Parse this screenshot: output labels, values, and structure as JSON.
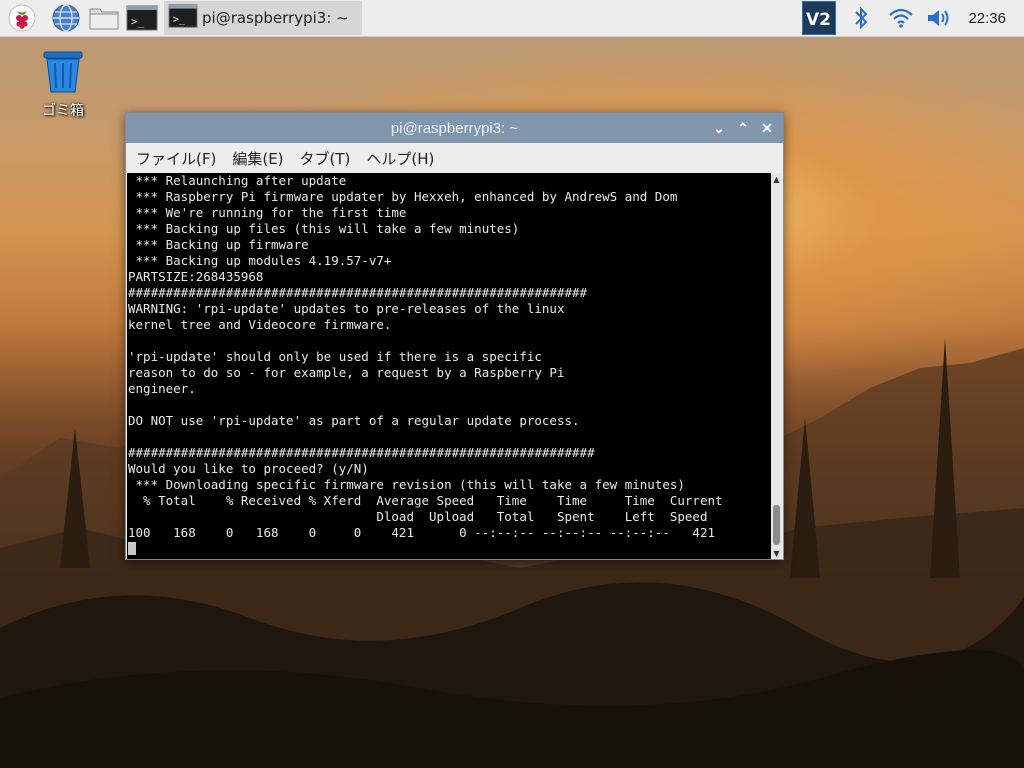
{
  "taskbar": {
    "menu_icon": "raspberry-menu-icon",
    "launchers": [
      "web-browser-icon",
      "file-manager-icon",
      "terminal-icon"
    ],
    "task_title": "pi@raspberrypi3: ~",
    "clock": "22:36",
    "tray_icons": [
      "vnc-icon",
      "bluetooth-icon",
      "wifi-icon",
      "volume-icon"
    ]
  },
  "desktop": {
    "trash_label": "ゴミ箱"
  },
  "window": {
    "title": "pi@raspberrypi3: ~",
    "menu": [
      "ファイル(F)",
      "編集(E)",
      "タブ(T)",
      "ヘルプ(H)"
    ],
    "terminal_lines": [
      " *** Relaunching after update",
      " *** Raspberry Pi firmware updater by Hexxeh, enhanced by AndrewS and Dom",
      " *** We're running for the first time",
      " *** Backing up files (this will take a few minutes)",
      " *** Backing up firmware",
      " *** Backing up modules 4.19.57-v7+",
      "PARTSIZE:268435968",
      "#############################################################",
      "WARNING: 'rpi-update' updates to pre-releases of the linux",
      "kernel tree and Videocore firmware.",
      "",
      "'rpi-update' should only be used if there is a specific",
      "reason to do so - for example, a request by a Raspberry Pi",
      "engineer.",
      "",
      "DO NOT use 'rpi-update' as part of a regular update process.",
      "",
      "##############################################################",
      "Would you like to proceed? (y/N)",
      " *** Downloading specific firmware revision (this will take a few minutes)",
      "  % Total    % Received % Xferd  Average Speed   Time    Time     Time  Current",
      "                                 Dload  Upload   Total   Spent    Left  Speed",
      "100   168    0   168    0     0    421      0 --:--:-- --:--:-- --:--:--   421"
    ]
  },
  "colors": {
    "titlebar": "#7f96ad",
    "terminal_bg": "#000000",
    "terminal_fg": "#e8e8e8"
  }
}
